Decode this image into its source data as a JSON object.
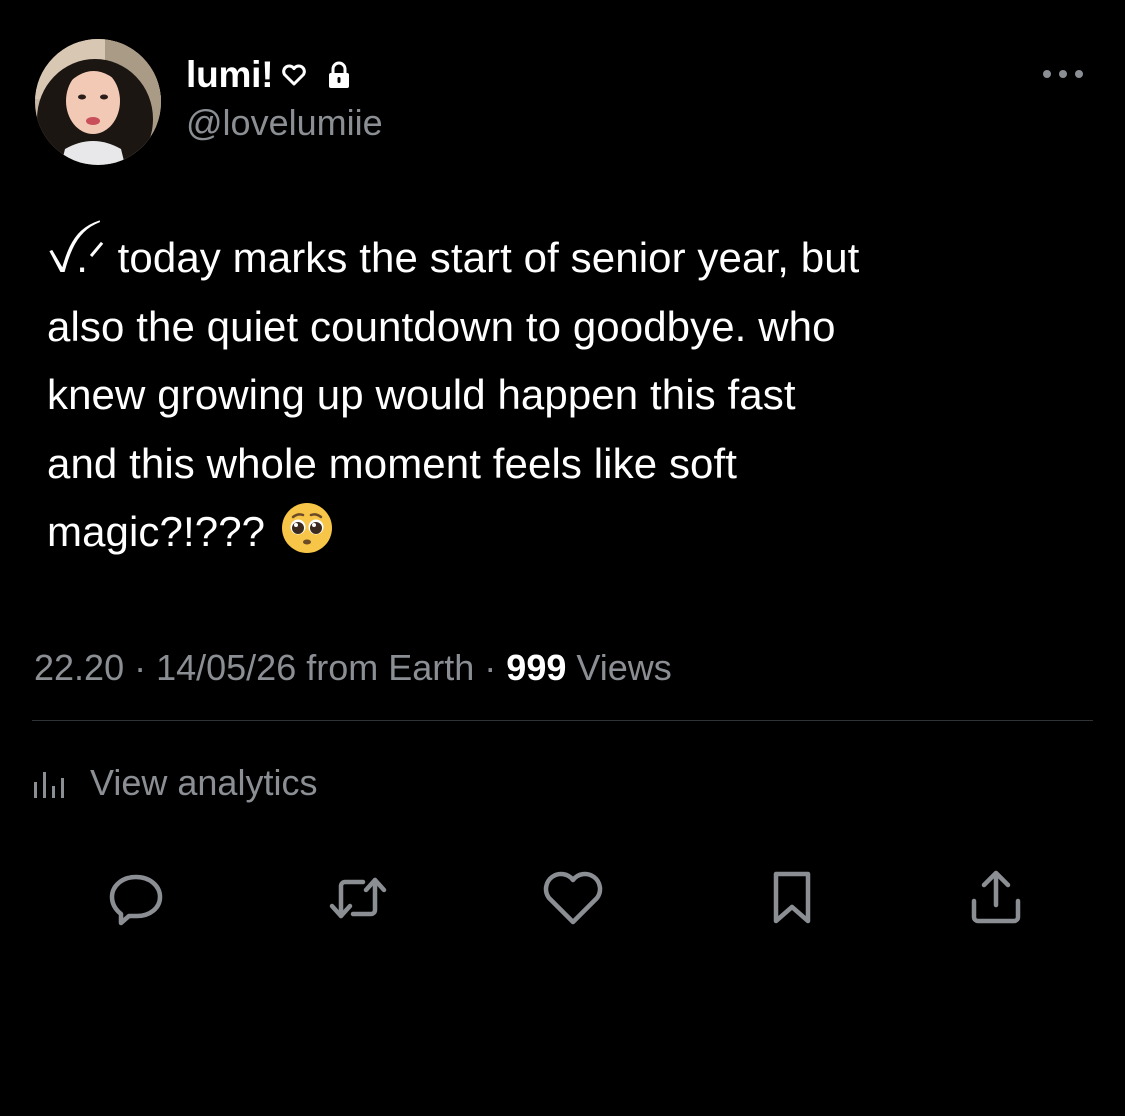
{
  "author": {
    "display_name": "lumi!",
    "handle": "@lovelumiie",
    "avatar_icon": "profile-photo",
    "badge_icons": [
      "heart-icon",
      "lock-icon"
    ]
  },
  "tweet": {
    "text": "ꪜ.ᐟ today marks the start of senior year, but\nalso the quiet countdown to goodbye. who\nknew growing up would happen this fast\nand this whole moment feels like soft\nmagic?!???",
    "emoji": "🥺"
  },
  "meta": {
    "time": "22.20",
    "sep1": " · ",
    "date": "14/05/26",
    "source": " from Earth",
    "sep2": " · ",
    "views_count": "999",
    "views_label": " Views"
  },
  "analytics": {
    "label": "View analytics",
    "icon": "bar-chart-icon"
  },
  "actions": [
    {
      "name": "reply",
      "icon": "reply-icon"
    },
    {
      "name": "repost",
      "icon": "repost-icon"
    },
    {
      "name": "like",
      "icon": "heart-icon"
    },
    {
      "name": "bookmark",
      "icon": "bookmark-icon"
    },
    {
      "name": "share",
      "icon": "share-icon"
    }
  ],
  "colors": {
    "background": "#000000",
    "primary_text": "#ffffff",
    "secondary_text": "#8b8f94",
    "divider": "#2f3336"
  }
}
